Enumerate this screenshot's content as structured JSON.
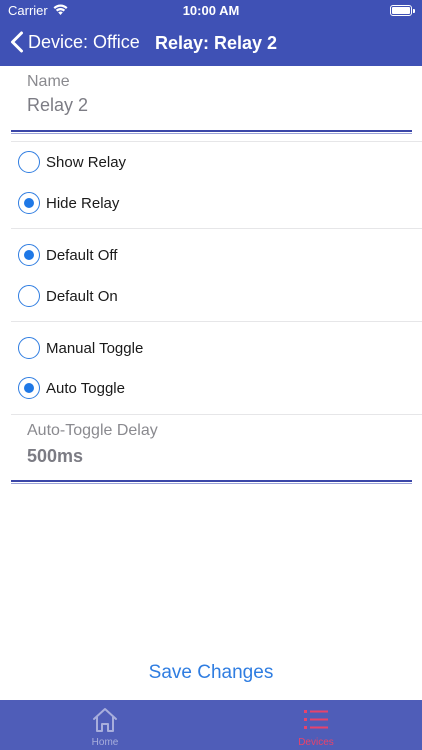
{
  "status_bar": {
    "carrier": "Carrier",
    "time": "10:00 AM"
  },
  "nav": {
    "back_label": "Device: Office",
    "title": "Relay: Relay 2"
  },
  "name_field": {
    "label": "Name",
    "value": "Relay 2"
  },
  "visibility": {
    "options": [
      {
        "label": "Show Relay",
        "checked": false
      },
      {
        "label": "Hide Relay",
        "checked": true
      }
    ]
  },
  "default_state": {
    "options": [
      {
        "label": "Default Off",
        "checked": true
      },
      {
        "label": "Default On",
        "checked": false
      }
    ]
  },
  "toggle_mode": {
    "options": [
      {
        "label": "Manual Toggle",
        "checked": false
      },
      {
        "label": "Auto Toggle",
        "checked": true
      }
    ]
  },
  "delay_field": {
    "label": "Auto-Toggle Delay",
    "value": "500ms"
  },
  "save_label": "Save Changes",
  "tabbar": {
    "items": [
      {
        "label": "Home",
        "icon": "home-icon",
        "active": false
      },
      {
        "label": "Devices",
        "icon": "list-icon",
        "active": true
      }
    ]
  },
  "colors": {
    "nav_bg": "#3f51b5",
    "tabbar_bg": "#4f5db8",
    "accent_blue": "#2f7de1",
    "tab_active": "#e8436b",
    "tab_inactive": "#a8aedc"
  }
}
